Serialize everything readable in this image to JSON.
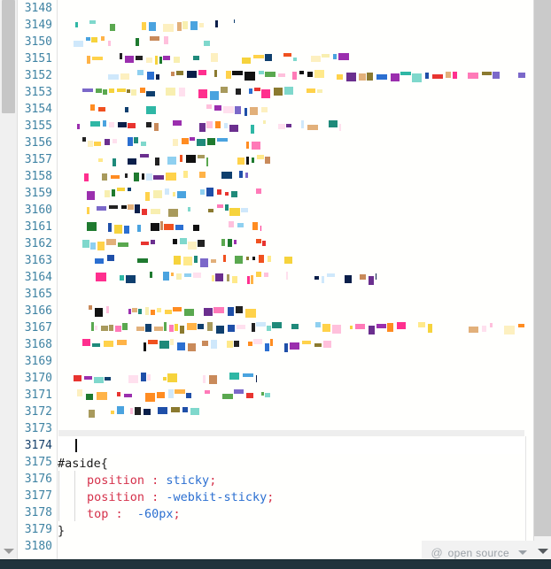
{
  "editor": {
    "first_line": 3148,
    "last_line": 3180,
    "active_line": 3174,
    "line_numbers": [
      3148,
      3149,
      3150,
      3151,
      3152,
      3153,
      3154,
      3155,
      3156,
      3157,
      3158,
      3159,
      3160,
      3161,
      3162,
      3163,
      3164,
      3165,
      3166,
      3167,
      3168,
      3169,
      3170,
      3171,
      3172,
      3173,
      3174,
      3175,
      3176,
      3177,
      3178,
      3179,
      3180
    ],
    "colors": {
      "background": "#fffffd",
      "line_number": "#3f83a3",
      "line_number_active": "#16406b",
      "property": "#d5314a",
      "value": "#2b6fd1",
      "selector": "#1a1a1a",
      "scrollbar_left": "#c6c6c6",
      "scrollbar_right": "#cacaca",
      "bottom_bar": "#20333c"
    },
    "code_lines": {
      "3174": [],
      "3175": [
        {
          "t": "#aside{",
          "c": "sel"
        }
      ],
      "3176": [
        {
          "t": "position",
          "c": "prop"
        },
        {
          "t": " : ",
          "c": "punct"
        },
        {
          "t": "sticky",
          "c": "val"
        },
        {
          "t": ";",
          "c": "punct"
        }
      ],
      "3177": [
        {
          "t": "position",
          "c": "prop"
        },
        {
          "t": " : ",
          "c": "punct"
        },
        {
          "t": "-webkit-sticky",
          "c": "val"
        },
        {
          "t": ";",
          "c": "punct"
        }
      ],
      "3178": [
        {
          "t": "top",
          "c": "prop"
        },
        {
          "t": " :  ",
          "c": "punct"
        },
        {
          "t": "-60px",
          "c": "val"
        },
        {
          "t": ";",
          "c": "punct"
        }
      ],
      "3179": [
        {
          "t": "}",
          "c": "sel"
        }
      ],
      "3180": []
    },
    "code_text": "#aside{\n    position : sticky;\n    position : -webkit-sticky;\n    top :  -60px;\n}"
  },
  "status": {
    "badge_icon": "at-icon",
    "badge_at": "@",
    "badge_label": "open source",
    "badge_caret": "chevron-down-icon"
  },
  "scrollbars": {
    "left_arrow": "chevron-down-icon",
    "right_arrow": "chevron-down-icon"
  }
}
